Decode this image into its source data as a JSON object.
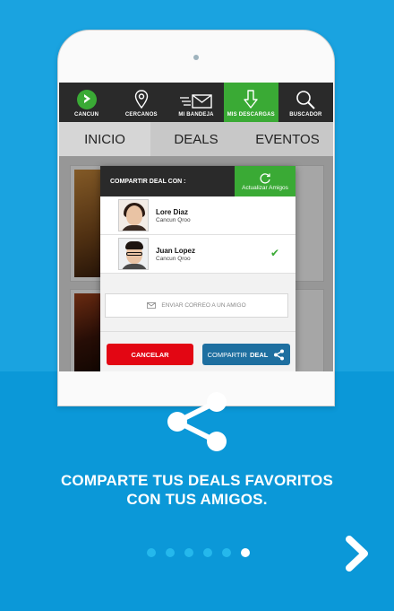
{
  "app_nav": {
    "items": [
      {
        "label": "CANCUN",
        "icon": "brand-logo-icon"
      },
      {
        "label": "CERCANOS",
        "icon": "map-pin-icon"
      },
      {
        "label": "MI BANDEJA",
        "icon": "mail-icon"
      },
      {
        "label": "MIS DESCARGAS",
        "icon": "download-icon",
        "active": true
      },
      {
        "label": "BUSCADOR",
        "icon": "search-icon"
      }
    ]
  },
  "tabs": [
    "INICIO",
    "DEALS",
    "EVENTOS"
  ],
  "modal": {
    "title": "COMPARTIR DEAL CON :",
    "refresh_label": "Actualizar Amigos",
    "friends": [
      {
        "name": "Lore Diaz",
        "location": "Cancun Qroo",
        "selected": false
      },
      {
        "name": "Juan Lopez",
        "location": "Cancun Qroo",
        "selected": true
      }
    ],
    "email_label": "ENVIAR CORREO A UN AMIGO",
    "cancel_label": "CANCELAR",
    "share_label_prefix": "COMPARTIR",
    "share_label_bold": "DEAL"
  },
  "promo": {
    "line1": "COMPARTE TUS DEALS FAVORITOS",
    "line2": "CON TUS AMIGOS."
  },
  "pager": {
    "total": 6,
    "current": 6
  },
  "colors": {
    "accent_green": "#3aaa35",
    "accent_red": "#e30613",
    "share_blue": "#1e6fa0",
    "background_blue": "#0b98d8"
  }
}
